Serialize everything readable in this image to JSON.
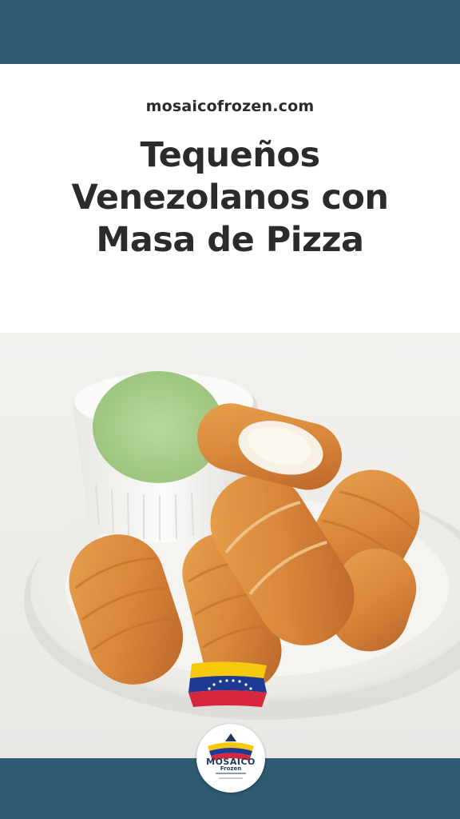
{
  "site": {
    "url": "mosaicofrozen.com"
  },
  "title": {
    "lines": [
      "Tequeños",
      "Venezolanos con",
      "Masa de Pizza"
    ]
  },
  "logo": {
    "text": "MOSAICO",
    "sub": "Frozen"
  },
  "colors": {
    "band": "#2e5a72",
    "title_text": "#2b2b2b",
    "background": "#ffffff"
  }
}
